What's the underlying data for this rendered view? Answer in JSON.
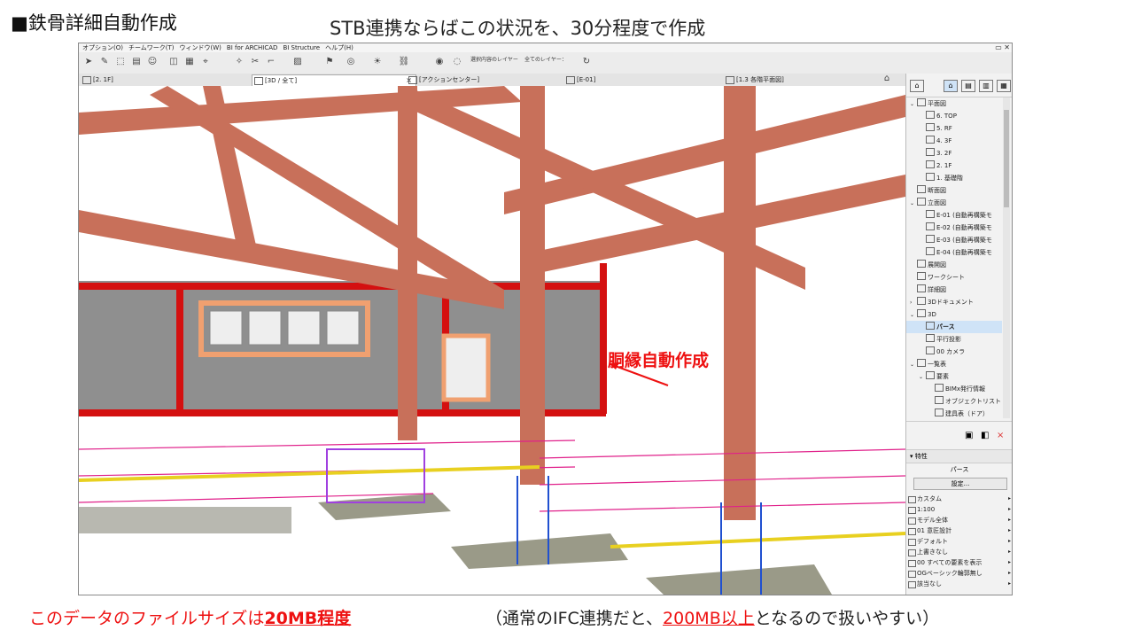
{
  "slide": {
    "title": "■鉄骨詳細自動作成",
    "subtitle": "STB連携ならばこの状況を、30分程度で作成",
    "annotation": "胴縁自動作成",
    "footer_left": {
      "prefix": "このデータのファイルサイズは",
      "highlight": "20MB程度"
    },
    "footer_right": {
      "prefix": "（通常のIFC連携だと、",
      "highlight": "200MB以上",
      "suffix": "となるので扱いやすい）"
    }
  },
  "app": {
    "menu": [
      "オプション(O)",
      "チームワーク(T)",
      "ウィンドウ(W)",
      "BI for ARCHICAD",
      "BI Structure",
      "ヘルプ(H)"
    ],
    "toolbar_labels": [
      "選択内容のレイヤー",
      "全てのレイヤー："
    ],
    "tabs": [
      {
        "label": "[2. 1F]",
        "active": false
      },
      {
        "label": "[3D / 全て]",
        "active": true
      },
      {
        "label": "[アクションセンター]",
        "active": false
      },
      {
        "label": "[E-01]",
        "active": false
      },
      {
        "label": "[1.3 各階平面図]",
        "active": false
      }
    ],
    "tab_close": "×",
    "tree": [
      {
        "label": "平面図",
        "level": 0,
        "chev": "v"
      },
      {
        "label": "6. TOP",
        "level": 1
      },
      {
        "label": "5. RF",
        "level": 1
      },
      {
        "label": "4. 3F",
        "level": 1
      },
      {
        "label": "3. 2F",
        "level": 1
      },
      {
        "label": "2. 1F",
        "level": 1
      },
      {
        "label": "1. 基礎階",
        "level": 1
      },
      {
        "label": "断面図",
        "level": 0
      },
      {
        "label": "立面図",
        "level": 0,
        "chev": "v"
      },
      {
        "label": "E-01 (自動再構築モ",
        "level": 1
      },
      {
        "label": "E-02 (自動再構築モ",
        "level": 1
      },
      {
        "label": "E-03 (自動再構築モ",
        "level": 1
      },
      {
        "label": "E-04 (自動再構築モ",
        "level": 1
      },
      {
        "label": "展開図",
        "level": 0
      },
      {
        "label": "ワークシート",
        "level": 0
      },
      {
        "label": "詳細図",
        "level": 0
      },
      {
        "label": "3Dドキュメント",
        "level": 0,
        "chev": ">"
      },
      {
        "label": "3D",
        "level": 0,
        "chev": "v"
      },
      {
        "label": "パース",
        "level": 1,
        "selected": true
      },
      {
        "label": "平行投影",
        "level": 1
      },
      {
        "label": "00 カメラ",
        "level": 1
      },
      {
        "label": "一覧表",
        "level": 0,
        "chev": "v"
      },
      {
        "label": "要素",
        "level": 1,
        "chev": "v"
      },
      {
        "label": "BIMx発行情報",
        "level": 2
      },
      {
        "label": "オブジェクトリスト",
        "level": 2
      },
      {
        "label": "建具表（ドア）",
        "level": 2
      }
    ],
    "properties": {
      "header": "特性",
      "name": "パース",
      "button": "設定...",
      "rows": [
        "カスタム",
        "1:100",
        "モデル全体",
        "01 意匠設計",
        "デフォルト",
        "上書きなし",
        "00 すべての要素を表示",
        "OGベーシック輪郭無し",
        "該当なし"
      ]
    },
    "panel_close": "×"
  }
}
